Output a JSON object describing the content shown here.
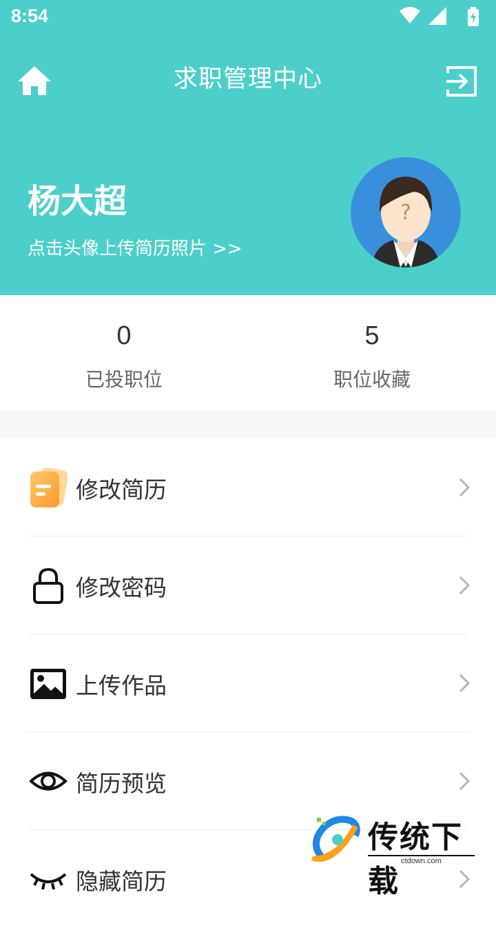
{
  "status_bar": {
    "time": "8:54",
    "icons": [
      "wifi-icon",
      "signal-icon",
      "battery-charging-icon"
    ]
  },
  "header": {
    "title": "求职管理中心",
    "home_icon": "home-icon",
    "logout_icon": "logout-icon"
  },
  "profile": {
    "name": "杨大超",
    "upload_tip": "点击头像上传简历照片 >>",
    "avatar_icon": "avatar-placeholder-icon"
  },
  "stats": [
    {
      "value": "0",
      "label": "已投职位"
    },
    {
      "value": "5",
      "label": "职位收藏"
    }
  ],
  "menu": [
    {
      "label": "修改简历",
      "icon": "resume-icon"
    },
    {
      "label": "修改密码",
      "icon": "lock-icon"
    },
    {
      "label": "上传作品",
      "icon": "image-icon"
    },
    {
      "label": "简历预览",
      "icon": "eye-icon"
    },
    {
      "label": "隐藏简历",
      "icon": "eye-closed-icon"
    }
  ],
  "watermark": {
    "text": "传统下载",
    "url": "ctdown.com"
  },
  "colors": {
    "primary": "#4ccfca",
    "avatar_bg": "#3a8fdc",
    "resume_icon": "#ffb347"
  }
}
